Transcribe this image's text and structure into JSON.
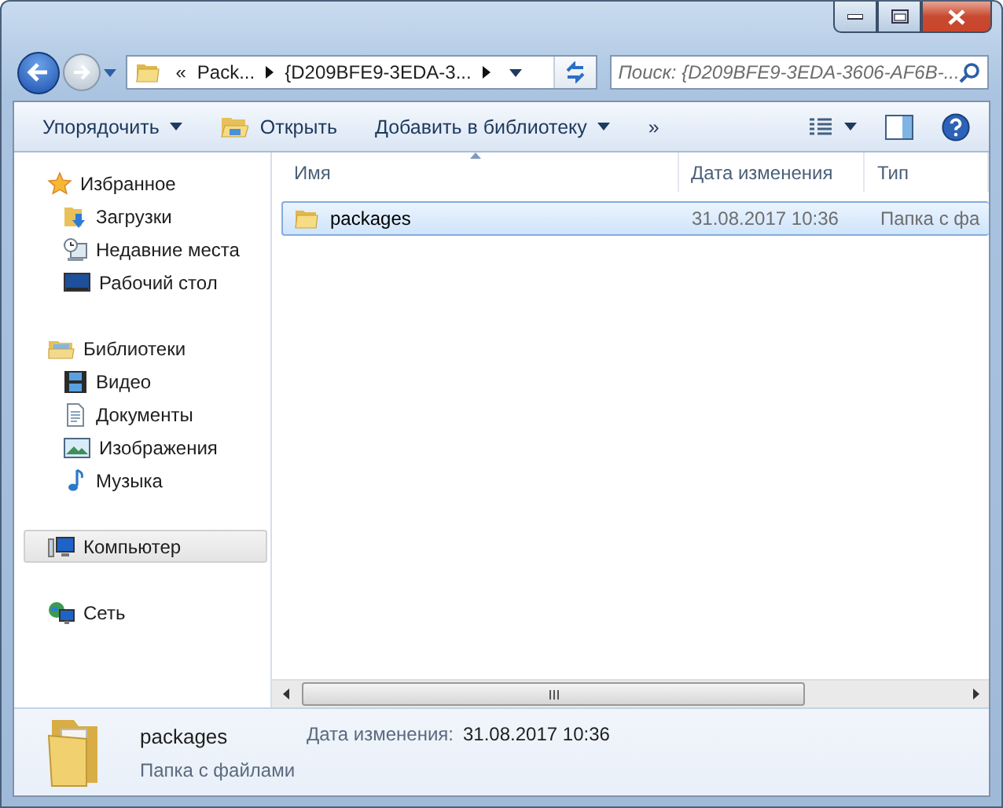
{
  "address": {
    "overflow": "«",
    "segments": [
      "Pack...",
      "{D209BFE9-3EDA-3..."
    ]
  },
  "search": {
    "placeholder": "Поиск: {D209BFE9-3EDA-3606-AF6B-..."
  },
  "toolbar": {
    "items": [
      {
        "label": "Упорядочить",
        "dropdown": true
      },
      {
        "label": "Открыть",
        "dropdown": false
      },
      {
        "label": "Добавить в библиотеку",
        "dropdown": true
      }
    ],
    "more": "»"
  },
  "sidebar": [
    {
      "label": "Избранное",
      "selected": false,
      "children": [
        {
          "label": "Загрузки",
          "selected": false
        },
        {
          "label": "Недавние места",
          "selected": false
        },
        {
          "label": "Рабочий стол",
          "selected": false
        }
      ]
    },
    {
      "label": "Библиотеки",
      "selected": false,
      "children": [
        {
          "label": "Видео",
          "selected": false
        },
        {
          "label": "Документы",
          "selected": false
        },
        {
          "label": "Изображения",
          "selected": false
        },
        {
          "label": "Музыка",
          "selected": false
        }
      ]
    },
    {
      "label": "Компьютер",
      "selected": true
    },
    {
      "label": "Сеть",
      "selected": false
    }
  ],
  "columns": [
    {
      "label": "Имя",
      "sorted": true
    },
    {
      "label": "Дата изменения",
      "sorted": false
    },
    {
      "label": "Тип",
      "sorted": false
    }
  ],
  "rows": [
    {
      "name": "packages",
      "date": "31.08.2017 10:36",
      "type": "Папка с фа",
      "selected": true
    }
  ],
  "details": {
    "name": "packages",
    "type": "Папка с файлами",
    "date_label": "Дата изменения:",
    "date": "31.08.2017 10:36"
  }
}
